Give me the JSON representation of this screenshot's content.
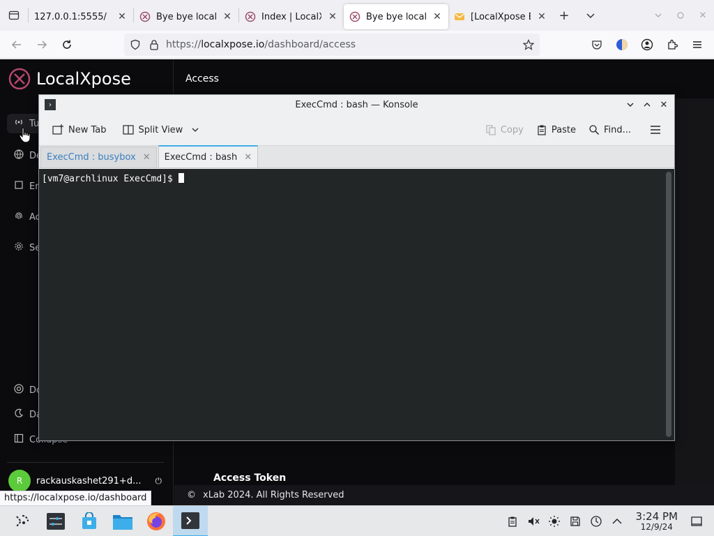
{
  "browser": {
    "tabs": [
      {
        "title": "127.0.0.1:5555/",
        "active": false,
        "icon": "none"
      },
      {
        "title": "Bye bye localhost",
        "active": false,
        "icon": "localxpose-icon"
      },
      {
        "title": "Index | LocalXpose",
        "active": false,
        "icon": "localxpose-icon"
      },
      {
        "title": "Bye bye localhost",
        "active": true,
        "icon": "localxpose-icon"
      },
      {
        "title": "[LocalXpose Email]",
        "active": false,
        "icon": "email-icon"
      }
    ],
    "url_prefix": "https://",
    "url_host": "localxpose.io",
    "url_path": "/dashboard/access",
    "status_url": "https://localxpose.io/dashboard"
  },
  "page": {
    "logo_text": "LocalXpose",
    "header_title": "Access",
    "sidebar": {
      "items": [
        {
          "label": "Tu",
          "icon": "broadcast-icon"
        },
        {
          "label": "De",
          "icon": "globe-icon"
        },
        {
          "label": "En",
          "icon": "frame-icon"
        },
        {
          "label": "Ac",
          "icon": "fingerprint-icon"
        },
        {
          "label": "Se",
          "icon": "gear-icon"
        }
      ],
      "bottom_items": [
        {
          "label": "Do",
          "icon": "lifebuoy-icon"
        },
        {
          "label": "Da",
          "icon": "moon-icon"
        },
        {
          "label": "Collapse",
          "icon": "collapse-icon"
        }
      ]
    },
    "user": {
      "initial": "R",
      "name": "rackauskashet291+d..."
    },
    "section_title": "Access Token",
    "footer": "xLab  2024. All Rights Reserved"
  },
  "konsole": {
    "window_title": "ExecCmd : bash — Konsole",
    "toolbar": {
      "new_tab": "New Tab",
      "split_view": "Split View",
      "copy": "Copy",
      "paste": "Paste",
      "find": "Find..."
    },
    "tabs": [
      {
        "title": "ExecCmd : busybox",
        "active": false
      },
      {
        "title": "ExecCmd : bash",
        "active": true
      }
    ],
    "prompt": "[vm7@archlinux ExecCmd]$ "
  },
  "taskbar": {
    "time": "3:24 PM",
    "date": "12/9/24"
  },
  "colors": {
    "accent": "#3daee9",
    "terminal_bg": "#232627",
    "page_bg": "#0b0b0d"
  }
}
